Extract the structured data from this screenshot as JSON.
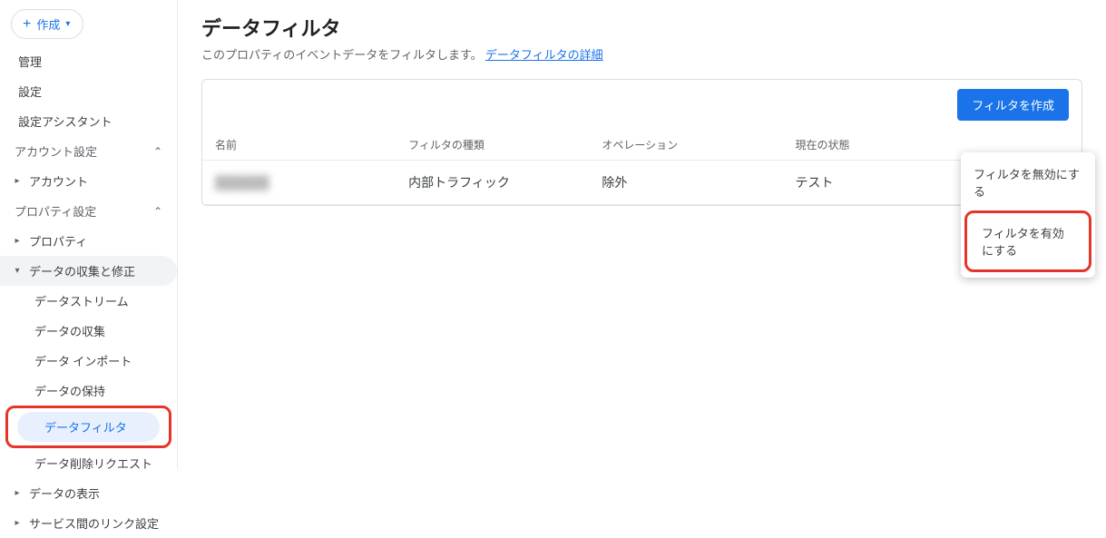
{
  "sidebar": {
    "create_label": "作成",
    "top": [
      "管理",
      "設定",
      "設定アシスタント"
    ],
    "account_group": "アカウント設定",
    "account_sub": "アカウント",
    "property_group": "プロパティ設定",
    "property_sub": "プロパティ",
    "data_collect": "データの収集と修正",
    "leaves": [
      "データストリーム",
      "データの収集",
      "データ インポート",
      "データの保持",
      "データフィルタ",
      "データ削除リクエスト"
    ],
    "data_display": "データの表示",
    "service_link": "サービス間のリンク設定"
  },
  "main": {
    "title": "データフィルタ",
    "desc_prefix": "このプロパティのイベントデータをフィルタします。",
    "desc_link": "データフィルタの詳細",
    "create_filter_btn": "フィルタを作成",
    "columns": {
      "name": "名前",
      "type": "フィルタの種類",
      "op": "オペレーション",
      "state": "現在の状態"
    },
    "rows": [
      {
        "name": "██████",
        "type": "内部トラフィック",
        "op": "除外",
        "state": "テスト"
      }
    ]
  },
  "popover": {
    "items": [
      "フィルタを無効にする",
      "フィルタを有効にする"
    ]
  }
}
